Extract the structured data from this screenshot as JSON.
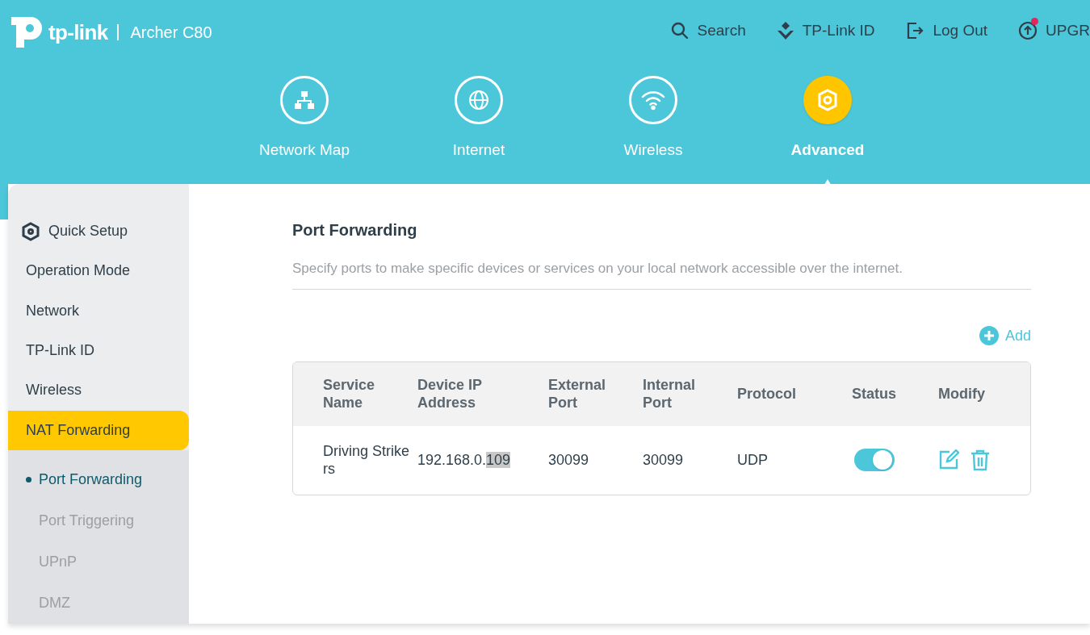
{
  "brand": {
    "logo": "tp-link",
    "model": "Archer C80"
  },
  "top_links": [
    {
      "label": "Search",
      "kind": "search"
    },
    {
      "label": "TP-Link ID",
      "kind": "id"
    },
    {
      "label": "Log Out",
      "kind": "logout"
    },
    {
      "label": "UPGR",
      "kind": "upgrade",
      "badge": true
    }
  ],
  "nav_tabs": [
    {
      "label": "Network Map",
      "kind": "map",
      "selected": false
    },
    {
      "label": "Internet",
      "kind": "globe",
      "selected": false
    },
    {
      "label": "Wireless",
      "kind": "wifi",
      "selected": false
    },
    {
      "label": "Advanced",
      "kind": "gear",
      "selected": true
    }
  ],
  "sidebar": {
    "items": [
      {
        "label": "Quick Setup",
        "icon": true,
        "selected": false
      },
      {
        "label": "Operation Mode",
        "icon": false,
        "selected": false
      },
      {
        "label": "Network",
        "icon": false,
        "selected": false
      },
      {
        "label": "TP-Link ID",
        "icon": false,
        "selected": false
      },
      {
        "label": "Wireless",
        "icon": false,
        "selected": false
      },
      {
        "label": "NAT Forwarding",
        "icon": false,
        "selected": true
      }
    ],
    "subitems": [
      {
        "label": "Port Forwarding",
        "selected": true
      },
      {
        "label": "Port Triggering",
        "selected": false
      },
      {
        "label": "UPnP",
        "selected": false
      },
      {
        "label": "DMZ",
        "selected": false
      }
    ]
  },
  "page": {
    "title": "Port Forwarding",
    "description": "Specify ports to make specific devices or services on your local network accessible over the internet.",
    "add_button": "Add"
  },
  "table": {
    "columns": [
      "Service Name",
      "Device IP Address",
      "External Port",
      "Internal Port",
      "Protocol",
      "Status",
      "Modify"
    ],
    "rows": [
      {
        "service_name": "Driving Strikers",
        "device_ip": "192.168.0.",
        "device_ip_selected": "109",
        "external_port": "30099",
        "internal_port": "30099",
        "protocol": "UDP",
        "status_on": true
      }
    ]
  }
}
